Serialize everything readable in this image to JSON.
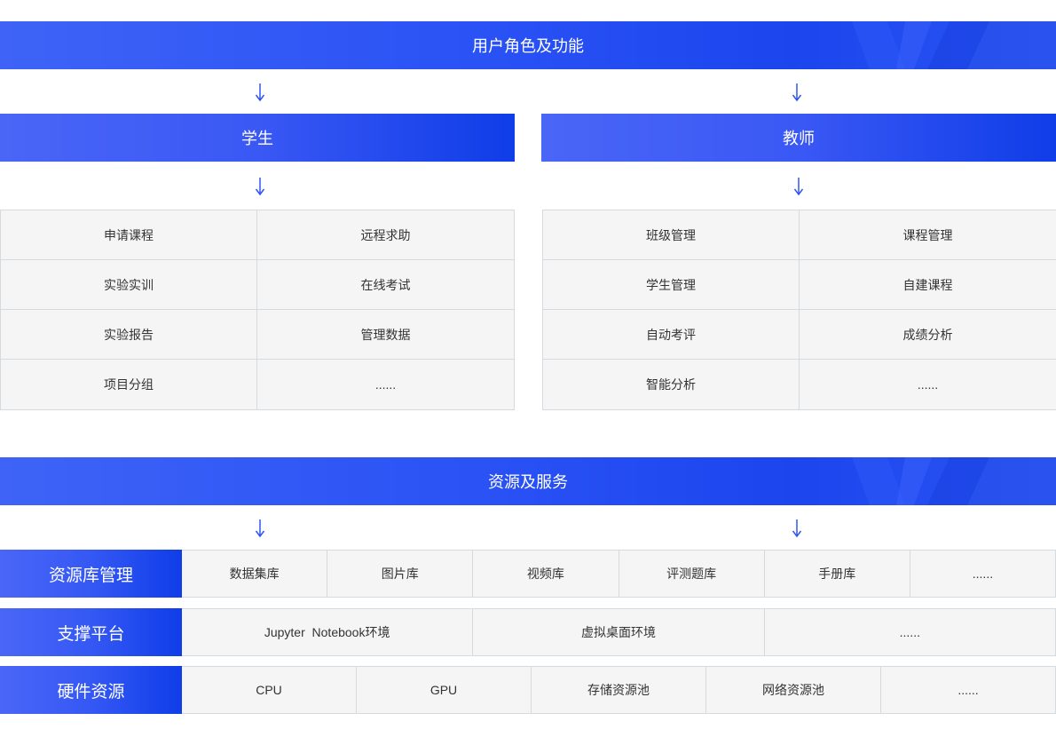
{
  "section1": {
    "title": "用户角色及功能",
    "roles": [
      {
        "name": "学生",
        "functions": [
          "申请课程",
          "远程求助",
          "实验实训",
          "在线考试",
          "实验报告",
          "管理数据",
          "项目分组",
          "......"
        ]
      },
      {
        "name": "教师",
        "functions": [
          "班级管理",
          "课程管理",
          "学生管理",
          "自建课程",
          "自动考评",
          "成绩分析",
          "智能分析",
          "......"
        ]
      }
    ]
  },
  "section2": {
    "title": "资源及服务",
    "rows": [
      {
        "label": "资源库管理",
        "items": [
          "数据集库",
          "图片库",
          "视频库",
          "评测题库",
          "手册库",
          "......"
        ]
      },
      {
        "label": "支撑平台",
        "items": [
          "Jupyter  Notebook环境",
          "虚拟桌面环境",
          "......"
        ]
      },
      {
        "label": "硬件资源",
        "items": [
          "CPU",
          "GPU",
          "存储资源池",
          "网络资源池",
          "......"
        ]
      }
    ]
  },
  "colors": {
    "primary_blue": "#2a52f5",
    "arrow_blue": "#2f55f0",
    "cell_bg": "#f5f5f5",
    "cell_border": "#d5d9e0"
  }
}
